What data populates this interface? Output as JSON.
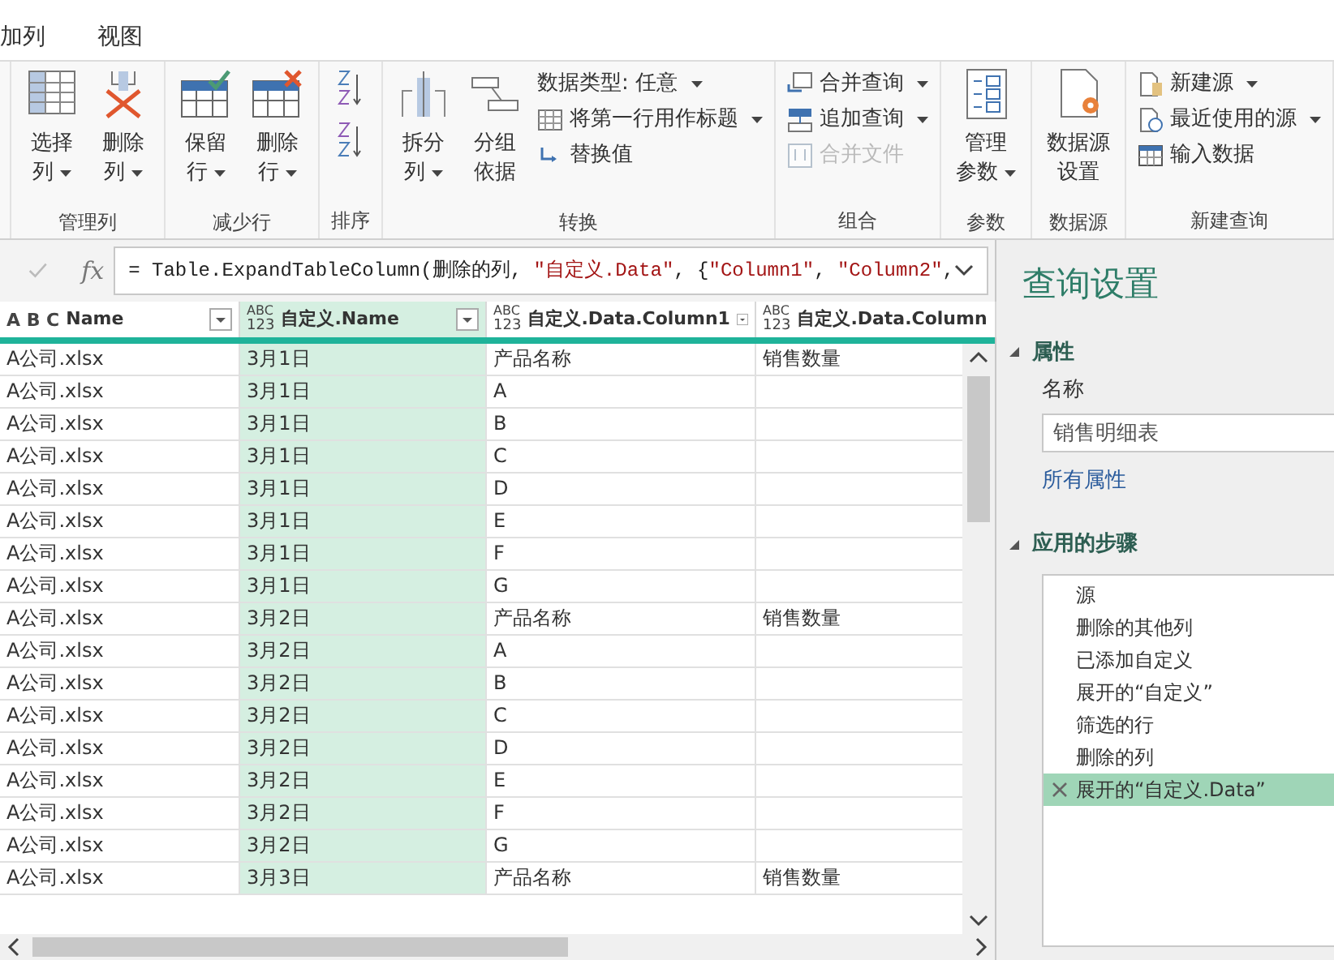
{
  "menu_tabs": [
    {
      "label": "加列"
    },
    {
      "label": "视图"
    }
  ],
  "ribbon": {
    "groups": [
      {
        "label": "管理列",
        "items": [
          {
            "kind": "large",
            "lines": [
              "选择",
              "列"
            ],
            "dropdown": true
          },
          {
            "kind": "large",
            "lines": [
              "删除",
              "列"
            ],
            "dropdown": true
          }
        ]
      },
      {
        "label": "减少行",
        "items": [
          {
            "kind": "large",
            "lines": [
              "保留",
              "行"
            ],
            "dropdown": true
          },
          {
            "kind": "large",
            "lines": [
              "删除",
              "行"
            ],
            "dropdown": true
          }
        ]
      },
      {
        "label": "排序",
        "items": [
          {
            "kind": "sort"
          }
        ]
      },
      {
        "label": "转换",
        "items": [
          {
            "kind": "large",
            "lines": [
              "拆分",
              "列"
            ],
            "dropdown": true
          },
          {
            "kind": "large",
            "lines": [
              "分组",
              "依据"
            ],
            "dropdown": false
          },
          {
            "kind": "stack",
            "rows": [
              {
                "label": "数据类型: 任意",
                "dropdown": true,
                "disabled": false
              },
              {
                "label": "将第一行用作标题",
                "dropdown": true,
                "disabled": false
              },
              {
                "label": "替换值",
                "dropdown": false,
                "disabled": false
              }
            ]
          }
        ]
      },
      {
        "label": "组合",
        "items": [
          {
            "kind": "stack",
            "rows": [
              {
                "label": "合并查询",
                "dropdown": true,
                "disabled": false
              },
              {
                "label": "追加查询",
                "dropdown": true,
                "disabled": false
              },
              {
                "label": "合并文件",
                "dropdown": false,
                "disabled": true
              }
            ]
          }
        ]
      },
      {
        "label": "参数",
        "items": [
          {
            "kind": "large",
            "lines": [
              "管理",
              "参数"
            ],
            "dropdown": true
          }
        ]
      },
      {
        "label": "数据源",
        "items": [
          {
            "kind": "large",
            "lines": [
              "数据源",
              "设置"
            ],
            "dropdown": false
          }
        ]
      },
      {
        "label": "新建查询",
        "items": [
          {
            "kind": "stack",
            "rows": [
              {
                "label": "新建源",
                "dropdown": true,
                "disabled": false
              },
              {
                "label": "最近使用的源",
                "dropdown": true,
                "disabled": false
              },
              {
                "label": "输入数据",
                "dropdown": false,
                "disabled": false
              }
            ]
          }
        ]
      }
    ]
  },
  "formula": {
    "function_label": "fx",
    "segments": [
      {
        "kind": "plain",
        "text": "= Table.ExpandTableColumn(删除的列, "
      },
      {
        "kind": "string",
        "text": "\"自定义.Data\""
      },
      {
        "kind": "plain",
        "text": ", {"
      },
      {
        "kind": "string",
        "text": "\"Column1\""
      },
      {
        "kind": "plain",
        "text": ", "
      },
      {
        "kind": "string",
        "text": "\"Column2\""
      },
      {
        "kind": "plain",
        "text": ","
      }
    ]
  },
  "table": {
    "columns": [
      {
        "name": "Name",
        "kind": "text",
        "type_glyphs": [
          "A",
          "B",
          "C"
        ],
        "selected": false
      },
      {
        "name": "自定义.Name",
        "kind": "any",
        "type_glyphs": [
          "ABC",
          "123"
        ],
        "selected": true
      },
      {
        "name": "自定义.Data.Column1",
        "kind": "any",
        "type_glyphs": [
          "ABC",
          "123"
        ],
        "selected": false
      },
      {
        "name": "自定义.Data.Column",
        "kind": "any",
        "type_glyphs": [
          "ABC",
          "123"
        ],
        "selected": false
      }
    ],
    "rows": [
      [
        "A公司.xlsx",
        "3月1日",
        "产品名称",
        "销售数量"
      ],
      [
        "A公司.xlsx",
        "3月1日",
        "A",
        ""
      ],
      [
        "A公司.xlsx",
        "3月1日",
        "B",
        ""
      ],
      [
        "A公司.xlsx",
        "3月1日",
        "C",
        ""
      ],
      [
        "A公司.xlsx",
        "3月1日",
        "D",
        ""
      ],
      [
        "A公司.xlsx",
        "3月1日",
        "E",
        ""
      ],
      [
        "A公司.xlsx",
        "3月1日",
        "F",
        ""
      ],
      [
        "A公司.xlsx",
        "3月1日",
        "G",
        ""
      ],
      [
        "A公司.xlsx",
        "3月2日",
        "产品名称",
        "销售数量"
      ],
      [
        "A公司.xlsx",
        "3月2日",
        "A",
        ""
      ],
      [
        "A公司.xlsx",
        "3月2日",
        "B",
        ""
      ],
      [
        "A公司.xlsx",
        "3月2日",
        "C",
        ""
      ],
      [
        "A公司.xlsx",
        "3月2日",
        "D",
        ""
      ],
      [
        "A公司.xlsx",
        "3月2日",
        "E",
        ""
      ],
      [
        "A公司.xlsx",
        "3月2日",
        "F",
        ""
      ],
      [
        "A公司.xlsx",
        "3月2日",
        "G",
        ""
      ],
      [
        "A公司.xlsx",
        "3月3日",
        "产品名称",
        "销售数量"
      ]
    ]
  },
  "query_settings": {
    "title": "查询设置",
    "properties": {
      "heading": "属性",
      "expanded": true,
      "name_label": "名称",
      "name_value": "销售明细表",
      "all_properties_link": "所有属性"
    },
    "steps_section": {
      "heading": "应用的步骤",
      "expanded": true,
      "steps": [
        {
          "label": "源",
          "selected": false
        },
        {
          "label": "删除的其他列",
          "selected": false
        },
        {
          "label": "已添加自定义",
          "selected": false
        },
        {
          "label": "展开的“自定义”",
          "selected": false
        },
        {
          "label": "筛选的行",
          "selected": false
        },
        {
          "label": "删除的列",
          "selected": false
        },
        {
          "label": "展开的“自定义.Data”",
          "selected": true
        }
      ]
    }
  }
}
